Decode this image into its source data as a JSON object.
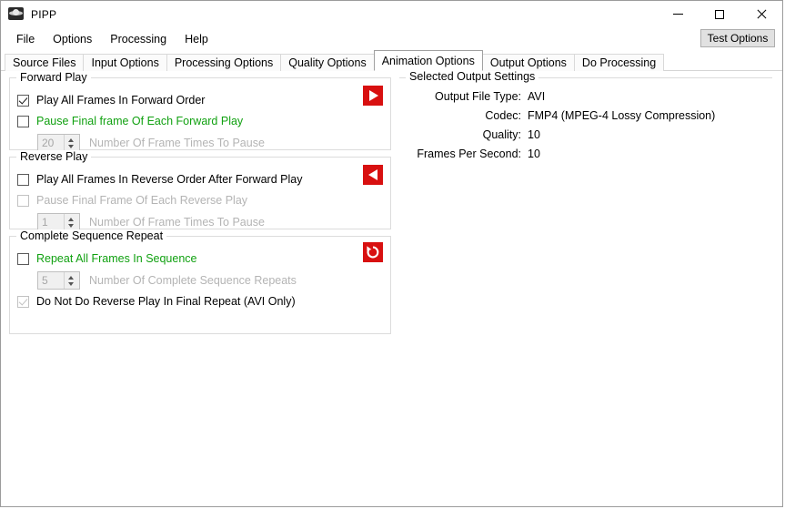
{
  "window": {
    "title": "PIPP",
    "app_icon": "planet-icon",
    "controls": {
      "minimize": "minimize-icon",
      "maximize": "maximize-icon",
      "close": "close-icon"
    }
  },
  "menubar": {
    "items": [
      {
        "label": "File"
      },
      {
        "label": "Options"
      },
      {
        "label": "Processing"
      },
      {
        "label": "Help"
      }
    ],
    "test_options_label": "Test Options"
  },
  "tabs": [
    {
      "label": "Source Files",
      "active": false
    },
    {
      "label": "Input Options",
      "active": false
    },
    {
      "label": "Processing Options",
      "active": false
    },
    {
      "label": "Quality Options",
      "active": false
    },
    {
      "label": "Animation Options",
      "active": true
    },
    {
      "label": "Output Options",
      "active": false
    },
    {
      "label": "Do Processing",
      "active": false
    }
  ],
  "forward_play": {
    "title": "Forward Play",
    "icon": "play-forward-icon",
    "play_all": {
      "label": "Play All Frames In Forward Order",
      "checked": true,
      "enabled": true,
      "style": "normal"
    },
    "pause_final": {
      "label": "Pause Final frame Of Each Forward Play",
      "checked": false,
      "enabled": true,
      "style": "green"
    },
    "pause_count": {
      "value": "20",
      "label": "Number Of Frame Times To Pause",
      "enabled": false
    }
  },
  "reverse_play": {
    "title": "Reverse Play",
    "icon": "play-reverse-icon",
    "play_all": {
      "label": "Play All Frames In Reverse Order After Forward Play",
      "checked": false,
      "enabled": true,
      "style": "normal"
    },
    "pause_final": {
      "label": "Pause Final Frame Of Each Reverse Play",
      "checked": false,
      "enabled": false,
      "style": "dim"
    },
    "pause_count": {
      "value": "1",
      "label": "Number Of Frame Times To Pause",
      "enabled": false
    }
  },
  "sequence_repeat": {
    "title": "Complete Sequence Repeat",
    "icon": "repeat-loop-icon",
    "repeat_all": {
      "label": "Repeat All Frames In Sequence",
      "checked": false,
      "enabled": true,
      "style": "green"
    },
    "repeat_count": {
      "value": "5",
      "label": "Number Of Complete Sequence Repeats",
      "enabled": false
    },
    "no_reverse_final": {
      "label": "Do Not Do Reverse Play In Final Repeat (AVI Only)",
      "checked": true,
      "enabled": false,
      "style": "normal"
    }
  },
  "output_settings": {
    "title": "Selected Output Settings",
    "rows": [
      {
        "key": "Output File Type:",
        "value": "AVI"
      },
      {
        "key": "Codec:",
        "value": "FMP4 (MPEG-4 Lossy Compression)"
      },
      {
        "key": "Quality:",
        "value": "10"
      },
      {
        "key": "Frames Per Second:",
        "value": "10"
      }
    ]
  },
  "colors": {
    "accent_red": "#d81010",
    "green_text": "#11a111",
    "disabled_text": "#b4b4b4",
    "tab_border": "#a0a0a0"
  }
}
